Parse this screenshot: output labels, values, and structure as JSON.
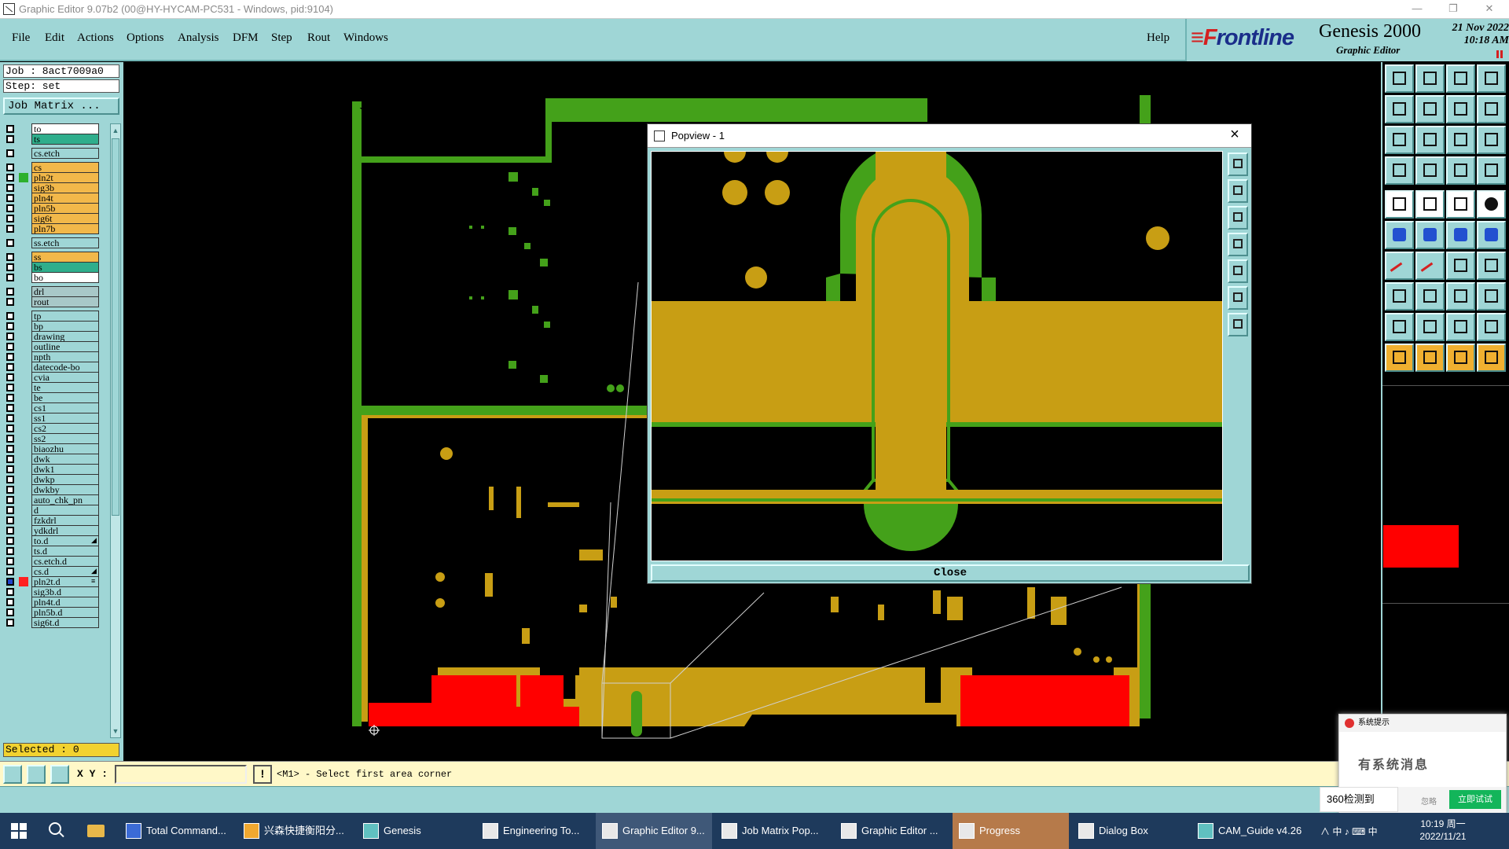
{
  "window": {
    "title": "Graphic Editor 9.07b2 (00@HY-HYCAM-PC531 - Windows, pid:9104)",
    "minimize": "—",
    "restore": "❐",
    "close": "✕"
  },
  "menu": {
    "items": [
      "File",
      "Edit",
      "Actions",
      "Options",
      "Analysis",
      "DFM",
      "Step",
      "Rout",
      "Windows"
    ],
    "help": "Help"
  },
  "brand": {
    "logo_f": "≡F",
    "logo_rest": "rontline",
    "product": "Genesis 2000",
    "subtitle": "Graphic Editor",
    "date": "21 Nov 2022",
    "time": "10:18 AM"
  },
  "left_panel": {
    "job": "Job : 8act7009a0",
    "step": "Step: set",
    "job_matrix_button": "Job Matrix ...",
    "layers": [
      {
        "name": "to",
        "color": "#ffffff"
      },
      {
        "name": "ts",
        "color": "#2fae8c"
      },
      {
        "name": "cs.etch",
        "color": "#9fd6d6",
        "gap": true
      },
      {
        "name": "cs",
        "color": "#f2b84a",
        "gap": true
      },
      {
        "name": "pln2t",
        "color": "#f2b84a",
        "mark": "#2db02d"
      },
      {
        "name": "sig3b",
        "color": "#f2b84a"
      },
      {
        "name": "pln4t",
        "color": "#f2b84a"
      },
      {
        "name": "pln5b",
        "color": "#f2b84a"
      },
      {
        "name": "sig6t",
        "color": "#f2b84a"
      },
      {
        "name": "pln7b",
        "color": "#f2b84a"
      },
      {
        "name": "ss.etch",
        "color": "#9fd6d6",
        "gap": true
      },
      {
        "name": "ss",
        "color": "#f2b84a",
        "gap": true
      },
      {
        "name": "bs",
        "color": "#2fae8c"
      },
      {
        "name": "bo",
        "color": "#ffffff"
      },
      {
        "name": "drl",
        "color": "#a8c8c8",
        "gap": true
      },
      {
        "name": "rout",
        "color": "#a8c8c8"
      },
      {
        "name": "tp",
        "color": "#9fd6d6",
        "gap": true
      },
      {
        "name": "bp",
        "color": "#9fd6d6"
      },
      {
        "name": "drawing",
        "color": "#9fd6d6"
      },
      {
        "name": "outline",
        "color": "#9fd6d6"
      },
      {
        "name": "npth",
        "color": "#9fd6d6"
      },
      {
        "name": "datecode-bo",
        "color": "#9fd6d6"
      },
      {
        "name": "cvia",
        "color": "#9fd6d6"
      },
      {
        "name": "te",
        "color": "#9fd6d6"
      },
      {
        "name": "be",
        "color": "#9fd6d6"
      },
      {
        "name": "cs1",
        "color": "#9fd6d6"
      },
      {
        "name": "ss1",
        "color": "#9fd6d6"
      },
      {
        "name": "cs2",
        "color": "#9fd6d6"
      },
      {
        "name": "ss2",
        "color": "#9fd6d6"
      },
      {
        "name": "biaozhu",
        "color": "#9fd6d6"
      },
      {
        "name": "dwk",
        "color": "#9fd6d6"
      },
      {
        "name": "dwk1",
        "color": "#9fd6d6"
      },
      {
        "name": "dwkp",
        "color": "#9fd6d6"
      },
      {
        "name": "dwkby",
        "color": "#9fd6d6"
      },
      {
        "name": "auto_chk_pn",
        "color": "#9fd6d6"
      },
      {
        "name": "d",
        "color": "#9fd6d6"
      },
      {
        "name": "fzkdrl",
        "color": "#9fd6d6"
      },
      {
        "name": "ydkdrl",
        "color": "#9fd6d6"
      },
      {
        "name": "to.d",
        "color": "#9fd6d6",
        "marker": "◢"
      },
      {
        "name": "ts.d",
        "color": "#9fd6d6"
      },
      {
        "name": "cs.etch.d",
        "color": "#9fd6d6"
      },
      {
        "name": "cs.d",
        "color": "#9fd6d6",
        "marker": "◢"
      },
      {
        "name": "pln2t.d",
        "color": "#9fd6d6",
        "mark": "#ff2020",
        "active": true,
        "marker": "≡"
      },
      {
        "name": "sig3b.d",
        "color": "#9fd6d6"
      },
      {
        "name": "pln4t.d",
        "color": "#9fd6d6"
      },
      {
        "name": "pln5b.d",
        "color": "#9fd6d6"
      },
      {
        "name": "sig6t.d",
        "color": "#9fd6d6"
      }
    ],
    "selected": "Selected : 0"
  },
  "popview": {
    "title": "Popview - 1",
    "close_button": "Close"
  },
  "statusbar": {
    "xy_label": "X Y :",
    "xy_value": "",
    "excl": "!",
    "message": "<M1> - Select first area corner"
  },
  "notification": {
    "header": "系统提示",
    "body": "有系统消息",
    "button": "立即试试",
    "tag": "360检测到",
    "ignore": "忽略"
  },
  "taskbar": {
    "items": [
      {
        "label": "Total Command...",
        "color": "#3b6bd6"
      },
      {
        "label": "兴森快捷衡阳分...",
        "color": "#f0a830"
      },
      {
        "label": "Genesis",
        "color": "#60c0c0"
      },
      {
        "label": "Engineering To...",
        "color": "#e8e8e8"
      },
      {
        "label": "Graphic Editor 9...",
        "color": "#e8e8e8",
        "active": true
      },
      {
        "label": "Job Matrix Pop...",
        "color": "#e8e8e8"
      },
      {
        "label": "Graphic Editor ...",
        "color": "#e8e8e8"
      },
      {
        "label": "Progress",
        "color": "#e8e8e8",
        "highlight": true
      },
      {
        "label": "Dialog Box",
        "color": "#e8e8e8"
      },
      {
        "label": "CAM_Guide v4.26",
        "color": "#60c0c0"
      }
    ],
    "tray": "∧  中  ♪  ⌨  中",
    "clock_time": "10:19 周一",
    "clock_date": "2022/11/21"
  },
  "colors": {
    "panel": "#9fd6d6",
    "copper": "#c89e14",
    "green": "#44a11a",
    "red": "#ff0000"
  }
}
